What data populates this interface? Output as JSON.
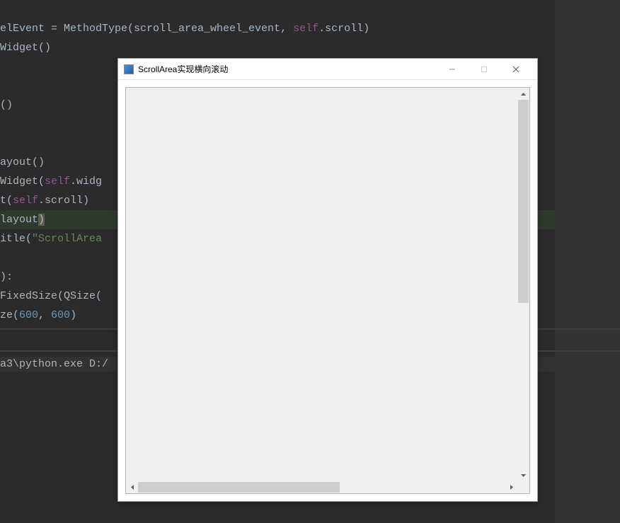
{
  "code": {
    "l1_a": "elEvent = MethodType(scroll_area_wheel_event, ",
    "l1_b": "self",
    "l1_c": ".scroll)",
    "l2": "Widget()",
    "l3": "",
    "l4": "",
    "l5": "()",
    "l6": "",
    "l7": "",
    "l8": "ayout()",
    "l9_a": "Widget(",
    "l9_b": "self",
    "l9_c": ".widg",
    "l10_a": "t(",
    "l10_b": "self",
    "l10_c": ".scroll)",
    "l11_a": "layout",
    "l11_b": ")",
    "l12_a": "itle(",
    "l12_b": "\"ScrollArea",
    "l13": "",
    "l14": "):",
    "l15": "FixedSize(QSize(",
    "l16_a": "ze(",
    "l16_b": "600",
    "l16_c": ", ",
    "l16_d": "600",
    "l16_e": ")"
  },
  "console": {
    "line": "a3\\python.exe D:/"
  },
  "window": {
    "title": "ScrollArea实现横向滚动",
    "minimize": "—",
    "maximize": "□",
    "close": "×"
  }
}
